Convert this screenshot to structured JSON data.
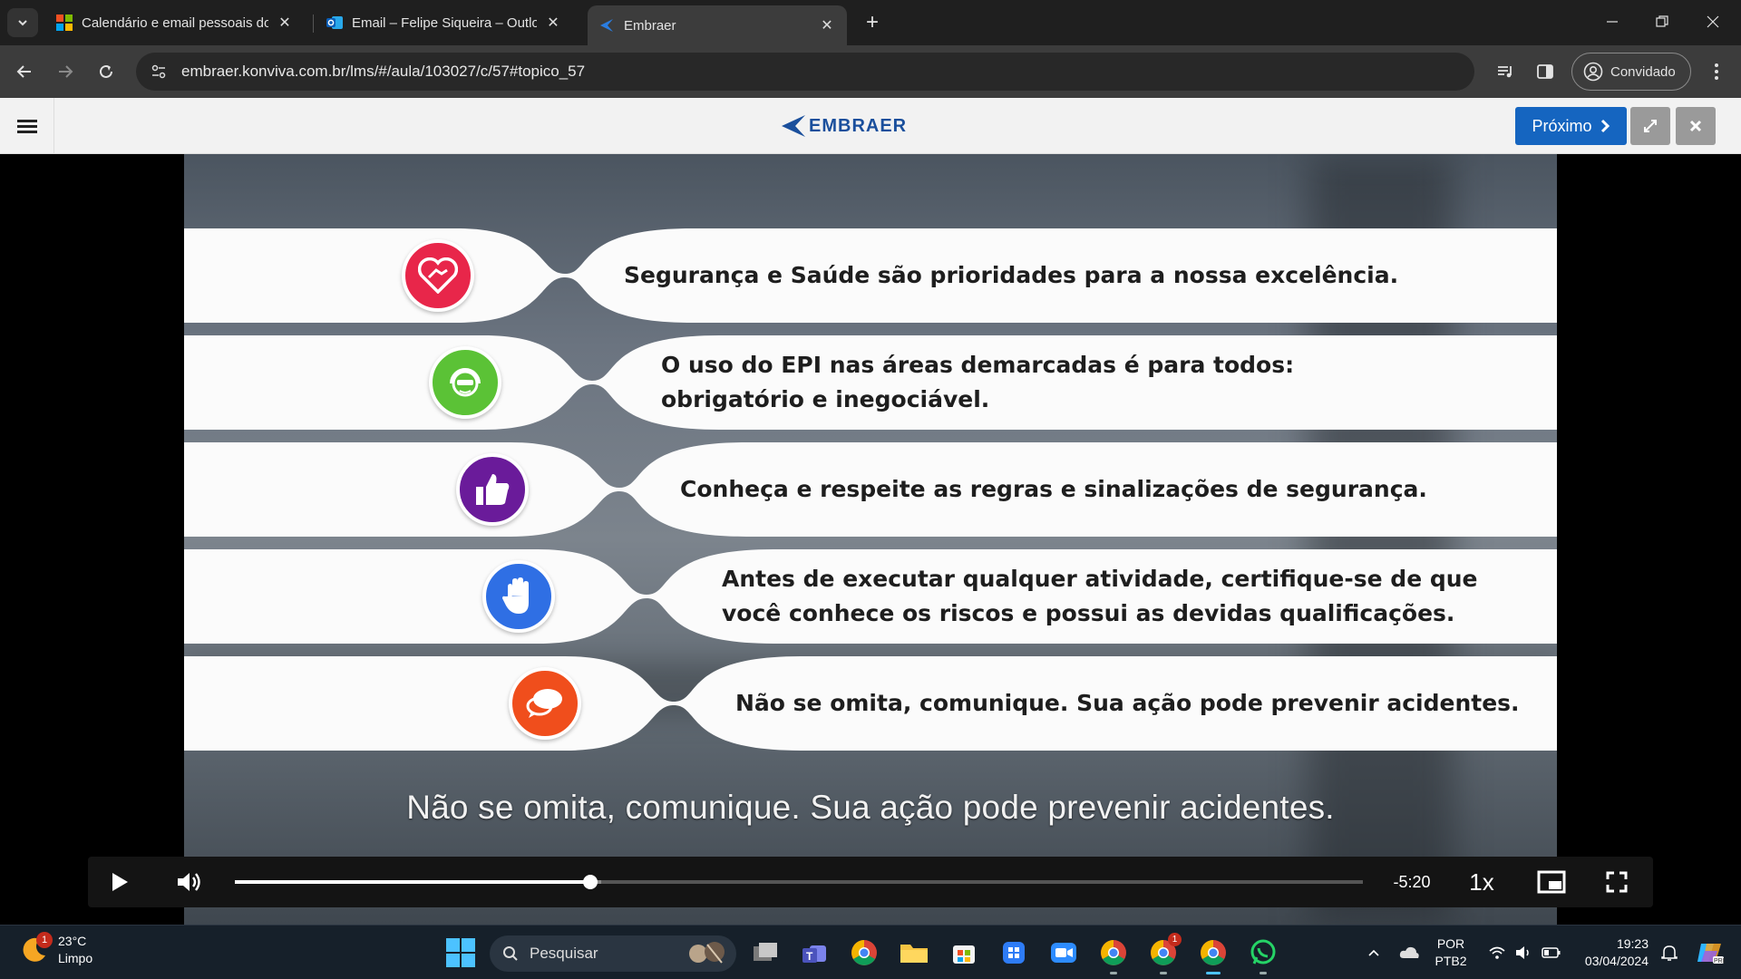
{
  "browser": {
    "tabs": [
      {
        "title": "Calendário e email pessoais do",
        "active": false
      },
      {
        "title": "Email – Felipe Siqueira – Outloo",
        "active": false
      },
      {
        "title": "Embraer",
        "active": true
      }
    ],
    "url": "embraer.konviva.com.br/lms/#/aula/103027/c/57#topico_57",
    "profile_label": "Convidado"
  },
  "lms": {
    "brand": "EMBRAER",
    "next_label": "Próximo"
  },
  "video": {
    "items": [
      {
        "icon": "handshake-icon",
        "color": "#e8264a",
        "lines": [
          "Segurança e Saúde são prioridades para a nossa excelência."
        ]
      },
      {
        "icon": "ppe-worker-icon",
        "color": "#5bc236",
        "lines": [
          "O uso do EPI nas áreas demarcadas é para todos:",
          "obrigatório e inegociável."
        ]
      },
      {
        "icon": "thumbs-up-icon",
        "color": "#6a1b9a",
        "lines": [
          "Conheça e respeite as regras e sinalizações de segurança."
        ]
      },
      {
        "icon": "stop-hand-icon",
        "color": "#2f6fe4",
        "lines": [
          "Antes de executar qualquer atividade, certifique-se de que",
          "você conhece os riscos e possui as devidas qualificações."
        ]
      },
      {
        "icon": "speech-bubbles-icon",
        "color": "#f04e1c",
        "lines": [
          "Não se omita, comunique. Sua ação pode prevenir acidentes."
        ]
      }
    ],
    "subtitle": "Não se omita, comunique. Sua ação pode prevenir acidentes.",
    "controls": {
      "progress": 0.315,
      "buffered": 0.325,
      "time_remaining": "-5:20",
      "speed": "1x"
    }
  },
  "taskbar": {
    "weather": {
      "temp": "23°C",
      "condition": "Limpo",
      "badge": "1"
    },
    "search_placeholder": "Pesquisar",
    "language": {
      "line1": "POR",
      "line2": "PTB2"
    },
    "clock": {
      "time": "19:23",
      "date": "03/04/2024"
    },
    "chrome_badge": "1"
  }
}
